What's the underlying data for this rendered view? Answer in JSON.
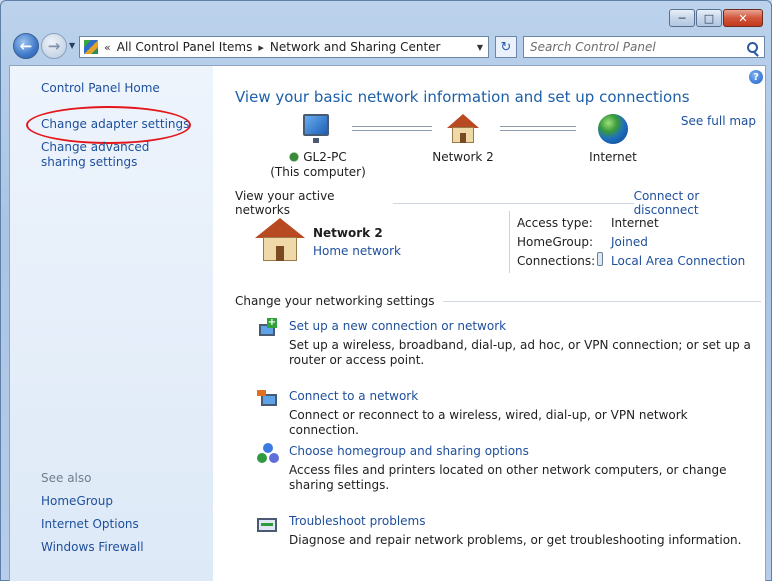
{
  "window": {
    "minimize": "─",
    "maximize": "□",
    "close": "✕"
  },
  "nav": {
    "back_glyph": "←",
    "forward_glyph": "→",
    "recent_glyph": "▼",
    "breadcrumb": [
      "«",
      "All Control Panel Items",
      "▸",
      "Network and Sharing Center"
    ],
    "dropdown_glyph": "▼",
    "refresh_glyph": "↻",
    "search_placeholder": "Search Control Panel"
  },
  "sidebar": {
    "home": "Control Panel Home",
    "change_adapter": "Change adapter settings",
    "advanced_sharing": "Change advanced sharing settings",
    "see_also_label": "See also",
    "see_also": [
      "HomeGroup",
      "Internet Options",
      "Windows Firewall"
    ]
  },
  "main": {
    "help_glyph": "?",
    "title": "View your basic network information and set up connections",
    "see_full_map": "See full map",
    "map": {
      "computer_name": "GL2-PC",
      "computer_sub": "(This computer)",
      "network": "Network  2",
      "internet": "Internet"
    },
    "active": {
      "header": "View your active networks",
      "connect_link": "Connect or disconnect",
      "network_name": "Network  2",
      "network_type": "Home network",
      "access_label": "Access type:",
      "access_value": "Internet",
      "homegroup_label": "HomeGroup:",
      "homegroup_value": "Joined",
      "connections_label": "Connections:",
      "connections_value": "Local Area Connection"
    },
    "settings_header": "Change your networking settings",
    "tasks": [
      {
        "link": "Set up a new connection or network",
        "desc": "Set up a wireless, broadband, dial-up, ad hoc, or VPN connection; or set up a router or access point."
      },
      {
        "link": "Connect to a network",
        "desc": "Connect or reconnect to a wireless, wired, dial-up, or VPN network connection."
      },
      {
        "link": "Choose homegroup and sharing options",
        "desc": "Access files and printers located on other network computers, or change sharing settings."
      },
      {
        "link": "Troubleshoot problems",
        "desc": "Diagnose and repair network problems, or get troubleshooting information."
      }
    ]
  },
  "colors": {
    "link": "#1e4f9c",
    "title": "#1d5fa8",
    "highlight_ring": "#e3161b"
  }
}
